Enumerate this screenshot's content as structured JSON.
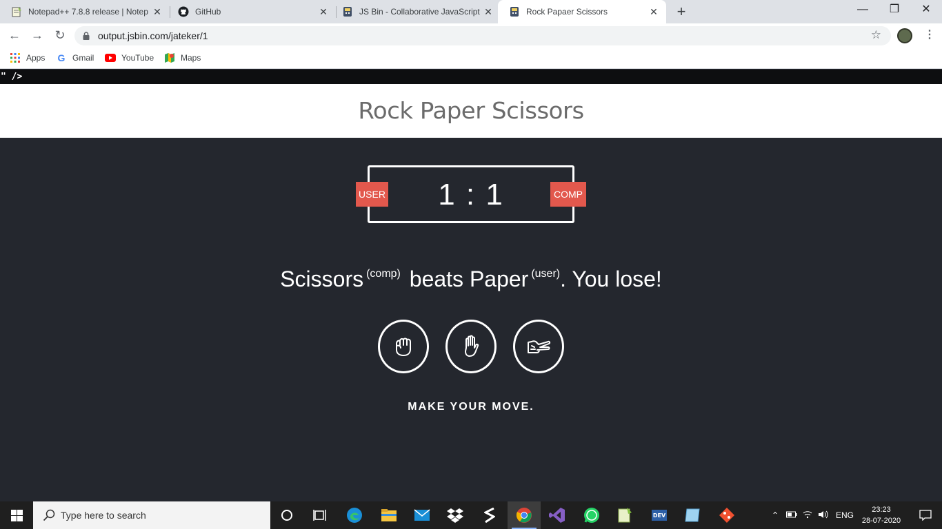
{
  "browser": {
    "tabs": [
      {
        "title": "Notepad++ 7.8.8 release | Notep",
        "icon": "notepad-icon"
      },
      {
        "title": "GitHub",
        "icon": "github-icon"
      },
      {
        "title": "JS Bin - Collaborative JavaScript [",
        "icon": "jsbin-icon"
      },
      {
        "title": "Rock Papaer Scissors",
        "icon": "jsbin-icon",
        "active": true
      }
    ],
    "tab_close": "✕",
    "new_tab": "+",
    "url": "output.jsbin.com/jateker/1",
    "bookmarks": [
      {
        "label": "Apps",
        "icon": "apps-grid-icon"
      },
      {
        "label": "Gmail",
        "icon": "google-icon"
      },
      {
        "label": "YouTube",
        "icon": "youtube-icon"
      },
      {
        "label": "Maps",
        "icon": "maps-icon"
      }
    ]
  },
  "page": {
    "artifact_text": "\" />",
    "title": "Rock Paper Scissors",
    "score": {
      "user_label": "USER",
      "comp_label": "COMP",
      "value": "1 : 1"
    },
    "result": {
      "comp_choice": "Scissors",
      "comp_tag": "(comp)",
      "middle": "beats",
      "user_choice": "Paper",
      "user_tag": "(user)",
      "ending": ". You lose!"
    },
    "choices": [
      "rock",
      "paper",
      "scissors"
    ],
    "prompt": "MAKE YOUR MOVE."
  },
  "taskbar": {
    "search_placeholder": "Type here to search",
    "apps": [
      "cortana-icon",
      "task-view-icon",
      "edge-icon",
      "file-explorer-icon",
      "mail-icon",
      "dropbox-icon",
      "sublime-icon",
      "chrome-icon",
      "visual-studio-icon",
      "whatsapp-icon",
      "notepadpp-icon",
      "devcpp-icon",
      "notes-icon",
      "git-icon"
    ],
    "language": "ENG",
    "time": "23:23",
    "date": "28-07-2020"
  },
  "colors": {
    "page_bg": "#24272e",
    "badge": "#e2584d",
    "header_bg": "#ffffff"
  }
}
